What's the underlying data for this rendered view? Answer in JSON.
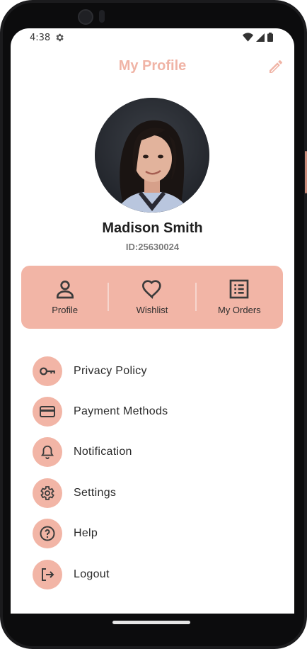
{
  "status_bar": {
    "time": "4:38",
    "icons": [
      "settings-icon",
      "wifi-icon",
      "signal-icon",
      "battery-icon"
    ]
  },
  "header": {
    "title": "My Profile",
    "edit_icon": "pencil-icon"
  },
  "profile": {
    "name": "Madison Smith",
    "id": "ID:25630024"
  },
  "quick_actions": [
    {
      "label": "Profile",
      "icon": "person-icon"
    },
    {
      "label": "Wishlist",
      "icon": "heart-icon"
    },
    {
      "label": "My Orders",
      "icon": "list-icon"
    }
  ],
  "menu": [
    {
      "label": "Privacy Policy",
      "icon": "key-icon"
    },
    {
      "label": "Payment Methods",
      "icon": "credit-card-icon"
    },
    {
      "label": "Notification",
      "icon": "bell-icon"
    },
    {
      "label": "Settings",
      "icon": "gear-icon"
    },
    {
      "label": "Help",
      "icon": "help-circle-icon"
    },
    {
      "label": "Logout",
      "icon": "logout-icon"
    }
  ],
  "colors": {
    "accent": "#f2b5a6",
    "title": "#f0b4a6",
    "text": "#2a2a2a",
    "id_text": "#7a7a7a"
  }
}
